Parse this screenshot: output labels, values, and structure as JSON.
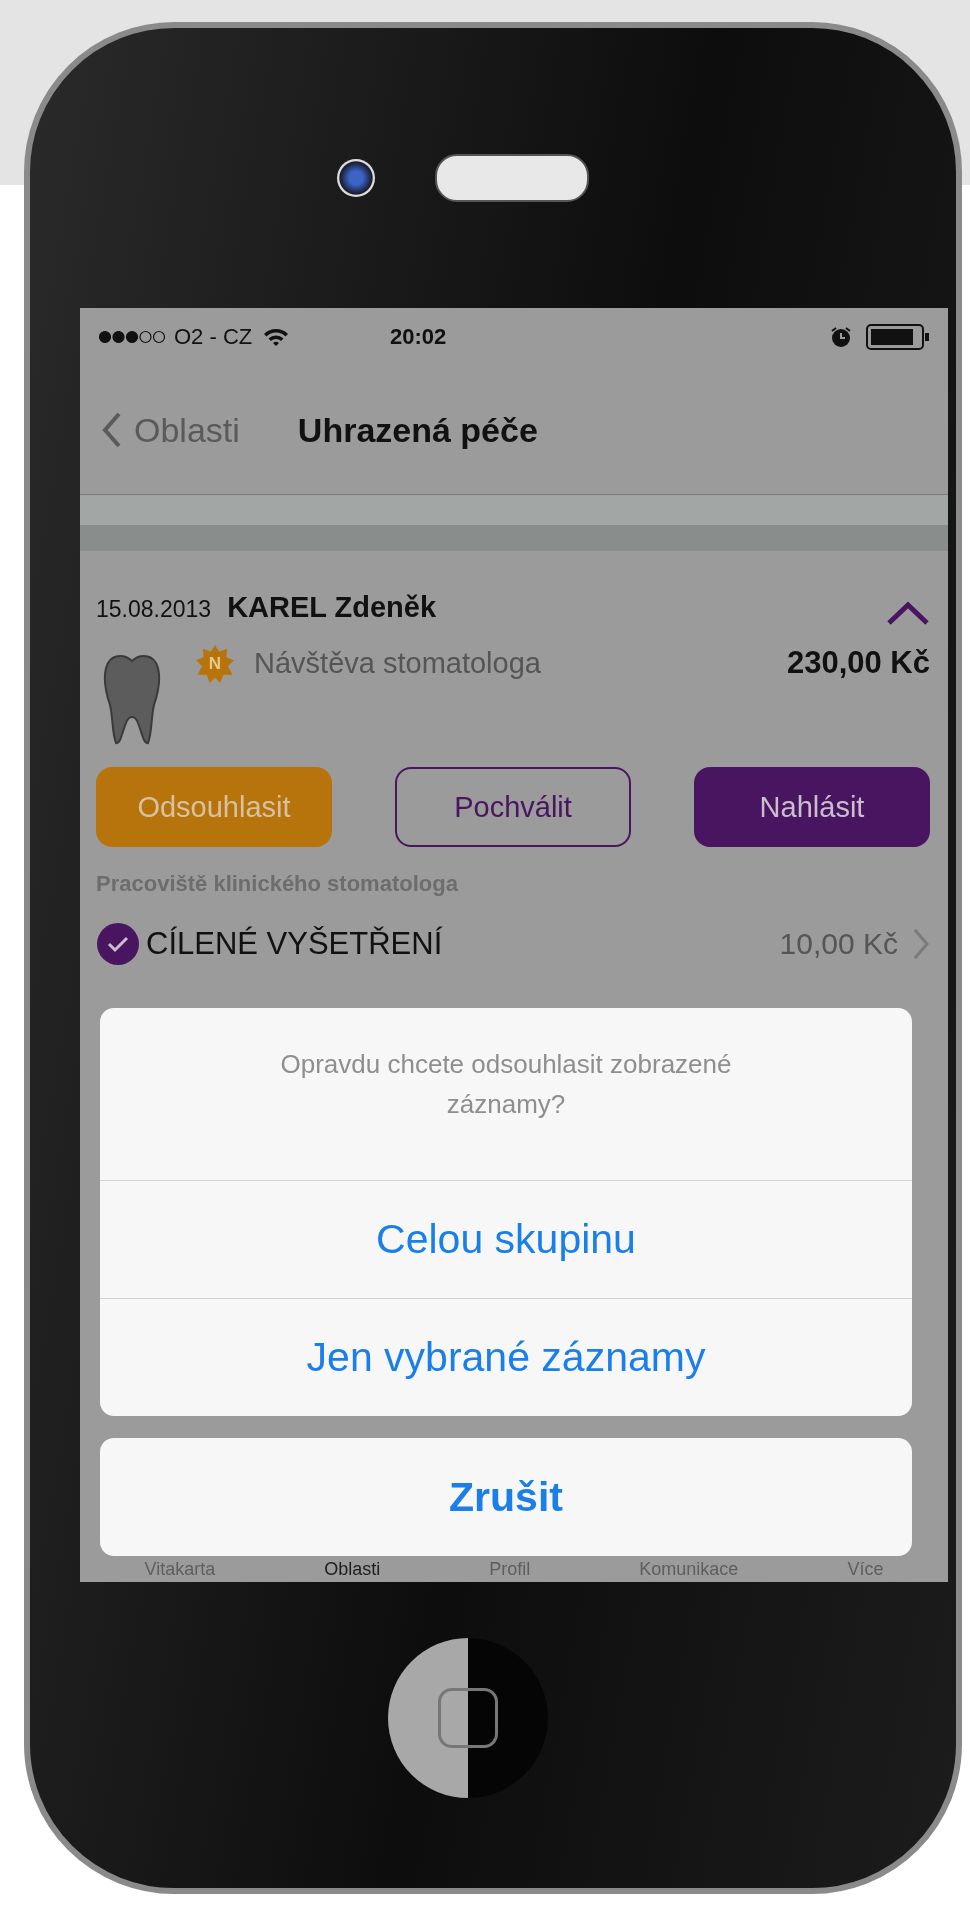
{
  "status_bar": {
    "carrier": "O2 - CZ",
    "time": "20:02"
  },
  "nav_bar": {
    "back": "Oblasti",
    "title": "Uhrazená péče"
  },
  "group": {
    "date": "15.08.2013",
    "name": "KAREL Zdeněk",
    "expanded": true,
    "visit": {
      "badge": "N",
      "label": "Návštěva stomatologa",
      "amount": "230,00 Kč"
    },
    "buttons": [
      {
        "label": "Odsouhlasit",
        "kind": "accept"
      },
      {
        "label": "Pochválit",
        "kind": "praise"
      },
      {
        "label": "Nahlásit",
        "kind": "report"
      }
    ],
    "workplace": "Pracoviště klinického stomatologa",
    "items": [
      {
        "label": "CÍLENÉ VYŠETŘENÍ",
        "checked": true,
        "amount": "10,00 Kč"
      }
    ]
  },
  "action_sheet": {
    "message": "Opravdu chcete odsouhlasit zobrazené záznamy?",
    "actions": [
      "Celou skupinu",
      "Jen vybrané záznamy"
    ],
    "cancel": "Zrušit"
  },
  "tab_bar": {
    "items": [
      {
        "label": "Vitakarta",
        "selected": false
      },
      {
        "label": "Oblasti",
        "selected": true
      },
      {
        "label": "Profil",
        "selected": false
      },
      {
        "label": "Komunikace",
        "selected": false
      },
      {
        "label": "Více",
        "selected": false
      }
    ]
  }
}
